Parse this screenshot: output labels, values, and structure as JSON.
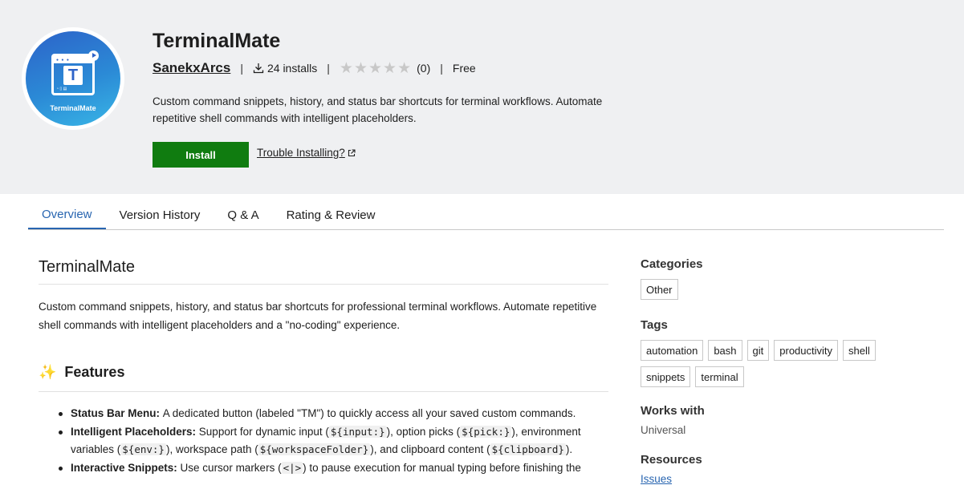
{
  "header": {
    "logo_text": "TerminalMate",
    "title": "TerminalMate",
    "publisher": "SanekxArcs",
    "installs": "24 installs",
    "rating_count": "(0)",
    "rating": 0,
    "rating_max": 5,
    "price": "Free",
    "description": "Custom command snippets, history, and status bar shortcuts for terminal workflows. Automate repetitive shell commands with intelligent placeholders.",
    "install_label": "Install",
    "trouble_label": "Trouble Installing?",
    "install_color": "#107c10"
  },
  "tabs": [
    {
      "label": "Overview",
      "active": true
    },
    {
      "label": "Version History",
      "active": false
    },
    {
      "label": "Q & A",
      "active": false
    },
    {
      "label": "Rating & Review",
      "active": false
    }
  ],
  "overview": {
    "title": "TerminalMate",
    "intro": "Custom command snippets, history, and status bar shortcuts for professional terminal workflows. Automate repetitive shell commands with intelligent placeholders and a \"no-coding\" experience.",
    "features_heading": "Features",
    "features": [
      {
        "name": "Status Bar Menu",
        "text": "A dedicated button (labeled \"TM\") to quickly access all your saved custom commands."
      },
      {
        "name": "Intelligent Placeholders",
        "text_1": "Support for dynamic input (",
        "code_1": "${input:}",
        "text_2": "), option picks (",
        "code_2": "${pick:}",
        "text_3": "), environment variables (",
        "code_3": "${env:}",
        "text_4": "), workspace path (",
        "code_4": "${workspaceFolder}",
        "text_5": "), and clipboard content (",
        "code_5": "${clipboard}",
        "text_6": ")."
      },
      {
        "name": "Interactive Snippets",
        "text_1": "Use cursor markers (",
        "code_1": "<|>",
        "text_2": ") to pause execution for manual typing before finishing the"
      }
    ]
  },
  "sidebar": {
    "categories_heading": "Categories",
    "categories": [
      "Other"
    ],
    "tags_heading": "Tags",
    "tags": [
      "automation",
      "bash",
      "git",
      "productivity",
      "shell",
      "snippets",
      "terminal"
    ],
    "works_with_heading": "Works with",
    "works_with": "Universal",
    "resources_heading": "Resources",
    "resources_link": "Issues"
  },
  "colors": {
    "accent": "#2865b0",
    "header_bg": "#eff0f2"
  }
}
